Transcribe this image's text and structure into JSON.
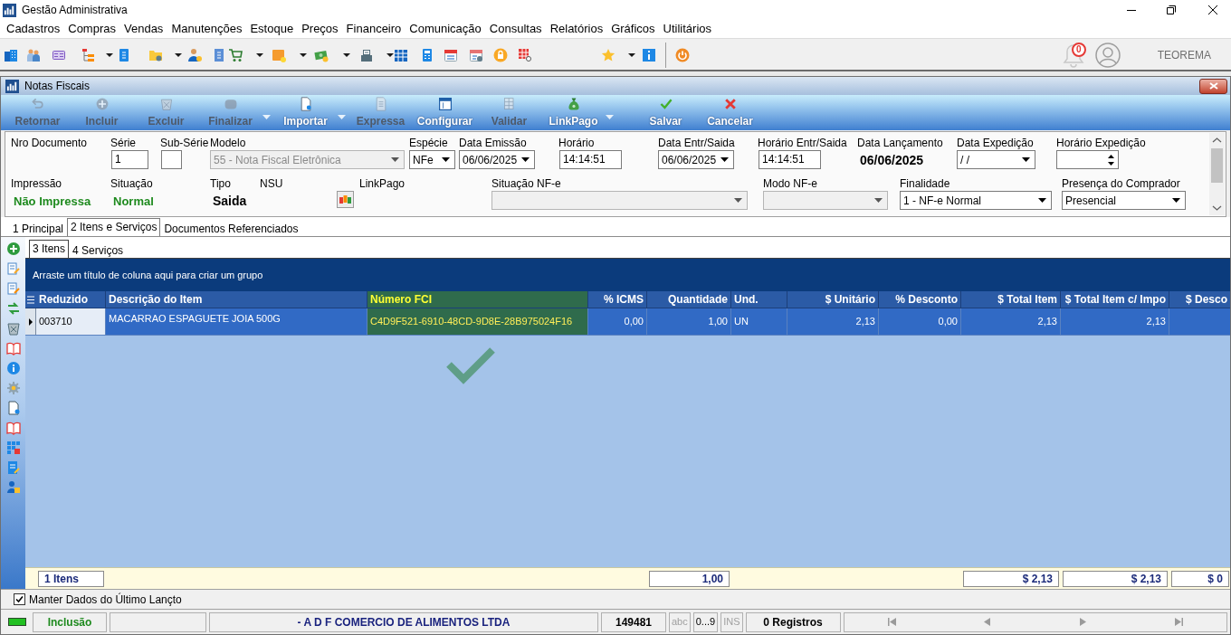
{
  "window": {
    "title": "Gestão Administrativa"
  },
  "menu": [
    "Cadastros",
    "Compras",
    "Vendas",
    "Manutenções",
    "Estoque",
    "Preços",
    "Financeiro",
    "Comunicação",
    "Consultas",
    "Relatórios",
    "Gráficos",
    "Utilitários"
  ],
  "toolbar": {
    "notification_count": "0",
    "user": "TEOREMA"
  },
  "child_window": {
    "title": "Notas Fiscais",
    "toolbar": [
      {
        "label": "Retornar",
        "disabled": true,
        "dropdown": false
      },
      {
        "label": "Incluir",
        "disabled": true,
        "dropdown": false
      },
      {
        "label": "Excluir",
        "disabled": true,
        "dropdown": false
      },
      {
        "label": "Finalizar",
        "disabled": true,
        "dropdown": true
      },
      {
        "label": "Importar",
        "disabled": false,
        "dropdown": true
      },
      {
        "label": "Expressa",
        "disabled": true,
        "dropdown": false
      },
      {
        "label": "Configurar",
        "disabled": false,
        "dropdown": false
      },
      {
        "label": "Validar",
        "disabled": true,
        "dropdown": false
      },
      {
        "label": "LinkPago",
        "disabled": false,
        "dropdown": true
      },
      {
        "label": "Salvar",
        "disabled": false,
        "dropdown": false
      },
      {
        "label": "Cancelar",
        "disabled": false,
        "dropdown": false
      }
    ],
    "form": {
      "row_1": [
        {
          "kind": "label",
          "label": "Nro Documento"
        },
        {
          "kind": "input",
          "label": "Série",
          "value": "1"
        },
        {
          "kind": "input",
          "label": "Sub-Série"
        },
        {
          "kind": "select",
          "label": "Modelo",
          "value": "55 - Nota Fiscal Eletrônica",
          "disabled": true
        },
        {
          "kind": "select",
          "label": "Espécie",
          "value": "NFe",
          "disabled": false
        },
        {
          "kind": "select",
          "label": "Data Emissão",
          "value": "06/06/2025",
          "disabled": false
        },
        {
          "kind": "input",
          "label": "Horário",
          "value": "14:14:51"
        },
        {
          "kind": "select",
          "label": "Data Entr/Saida",
          "value": "06/06/2025",
          "disabled": false
        },
        {
          "kind": "input",
          "label": "Horário Entr/Saida",
          "value": "14:14:51"
        },
        {
          "kind": "value",
          "label": "Data Lançamento",
          "value": "06/06/2025"
        },
        {
          "kind": "select",
          "label": "Data Expedição",
          "value": "/ /",
          "disabled": false
        },
        {
          "kind": "spin",
          "label": "Horário Expedição"
        }
      ],
      "row_2": [
        {
          "kind": "status",
          "label": "Impressão",
          "value": "Não Impressa"
        },
        {
          "kind": "status",
          "label": "Situação",
          "value": "Normal"
        },
        {
          "kind": "value",
          "label": "Tipo",
          "value": "Saida"
        },
        {
          "kind": "label",
          "label": "NSU"
        },
        {
          "kind": "icon-button"
        },
        {
          "kind": "label",
          "label": "LinkPago"
        },
        {
          "kind": "select",
          "label": "Situação NF-e",
          "disabled": true
        },
        {
          "kind": "select",
          "label": "Modo NF-e",
          "disabled": true
        },
        {
          "kind": "select",
          "label": "Finalidade",
          "value": "1 - NF-e Normal",
          "disabled": false
        },
        {
          "kind": "select",
          "label": "Presença do Comprador",
          "value": "Presencial",
          "disabled": false
        }
      ]
    },
    "tabs": [
      {
        "label": "1 Principal",
        "selected": false
      },
      {
        "label": "2 Itens e Serviços",
        "selected": true
      },
      {
        "label": "Documentos Referenciados",
        "selected": false
      }
    ],
    "items_tabs": [
      {
        "label": "3 Itens",
        "selected": true
      },
      {
        "label": "4 Serviços",
        "selected": false
      }
    ],
    "grid": {
      "group_hint": "Arraste um título de coluna aqui para criar um grupo",
      "columns": [
        {
          "label": "Reduzido",
          "kind": "text",
          "selected": false,
          "summary": "1 Itens"
        },
        {
          "label": "Descrição do Item",
          "kind": "memo",
          "selected": false
        },
        {
          "label": "Número FCI",
          "kind": "text",
          "selected": true
        },
        {
          "label": "% ICMS",
          "kind": "number",
          "selected": false
        },
        {
          "label": "Quantidade",
          "kind": "number",
          "selected": false,
          "summary": "1,00"
        },
        {
          "label": "Und.",
          "kind": "text",
          "selected": false
        },
        {
          "label": "$ Unitário",
          "kind": "number",
          "selected": false
        },
        {
          "label": "% Desconto",
          "kind": "number",
          "selected": false
        },
        {
          "label": "$ Total Item",
          "kind": "number",
          "selected": false,
          "summary": "$ 2,13"
        },
        {
          "label": "$ Total Item c/ Impo",
          "kind": "number",
          "selected": false,
          "summary": "$ 2,13"
        },
        {
          "label": "$ Desco",
          "kind": "number",
          "selected": false,
          "summary": "$ 0"
        }
      ],
      "rows": [
        {
          "selected": true,
          "cells": [
            {
              "text": "003710",
              "focused": true
            },
            {
              "text": "MACARRAO ESPAGUETE JOIA 500G",
              "focused": false
            },
            {
              "text": "C4D9F521-6910-48CD-9D8E-28B975024F16",
              "focused": false
            },
            {
              "text": "0,00",
              "focused": false
            },
            {
              "text": "1,00",
              "focused": false
            },
            {
              "text": "UN",
              "focused": false
            },
            {
              "text": "2,13",
              "focused": false
            },
            {
              "text": "0,00",
              "focused": false
            },
            {
              "text": "2,13",
              "focused": false
            },
            {
              "text": "2,13",
              "focused": false
            }
          ]
        }
      ]
    },
    "keep_data": {
      "label": "Manter Dados do Último Lançto",
      "checked": true
    },
    "status_bar": {
      "mode": "Inclusão",
      "company": "- A D F COMERCIO DE ALIMENTOS LTDA",
      "code": "149481",
      "indicators": [
        {
          "label": "abc",
          "active": false
        },
        {
          "label": "0...9",
          "active": true
        },
        {
          "label": "INS",
          "active": false
        }
      ],
      "records": "0 Registros"
    }
  }
}
